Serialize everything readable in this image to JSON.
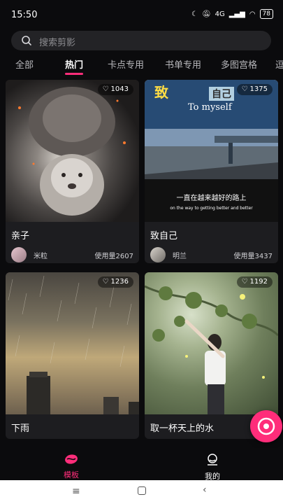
{
  "status_bar": {
    "time": "15:50",
    "battery": "78",
    "network": "4G"
  },
  "search": {
    "placeholder": "搜索剪影"
  },
  "tabs": [
    {
      "label": "全部"
    },
    {
      "label": "热门"
    },
    {
      "label": "卡点专用"
    },
    {
      "label": "书单专用"
    },
    {
      "label": "多图宫格"
    },
    {
      "label": "逗"
    }
  ],
  "active_tab_index": 1,
  "cards": [
    {
      "title": "亲子",
      "likes": "1043",
      "author": "米粒",
      "usage": "使用量2607"
    },
    {
      "title": "致自己",
      "likes": "1375",
      "author": "明兰",
      "usage": "使用量3437",
      "overlay_title": "致",
      "overlay_subtitle": "自己",
      "overlay_en": "To myself",
      "overlay_line1": "一直在越来越好的路上",
      "overlay_line2": "on the way to getting better and better"
    },
    {
      "title": "下雨",
      "likes": "1236"
    },
    {
      "title": "取一杯天上的水",
      "likes": "1192"
    }
  ],
  "bottom_nav": [
    {
      "label": "模板",
      "active": true
    },
    {
      "label": "我的",
      "active": false
    }
  ],
  "colors": {
    "accent": "#ff2d7a",
    "background": "#0b0b0d",
    "card": "#1d1d20"
  }
}
